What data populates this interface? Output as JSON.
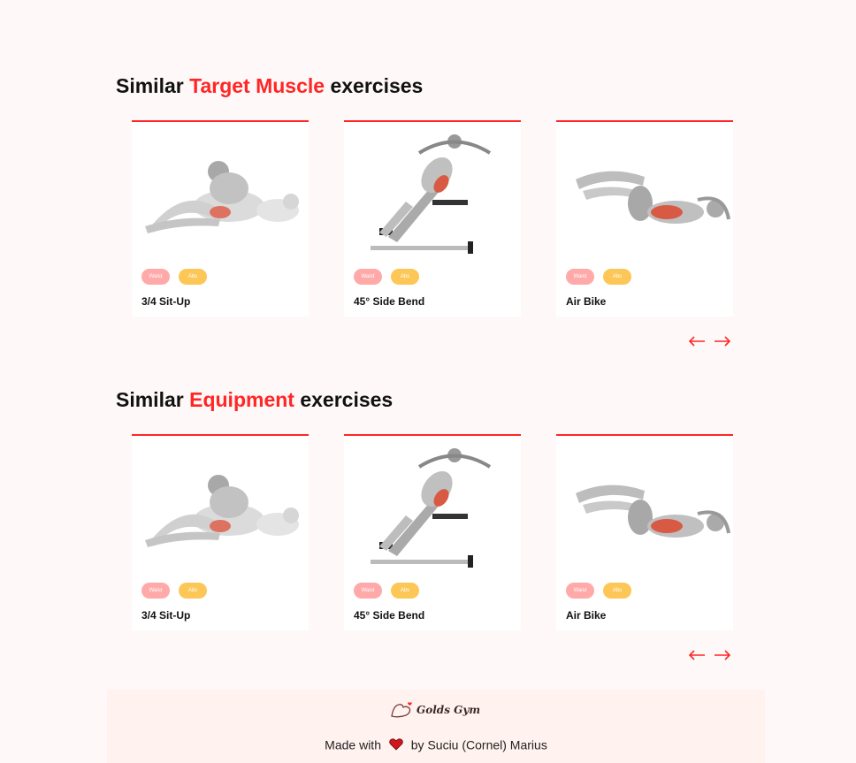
{
  "sections": [
    {
      "title_prefix": "Similar ",
      "title_accent": "Target Muscle",
      "title_suffix": " exercises",
      "cards": [
        {
          "name": "3/4 Sit-Up",
          "tags": [
            "Waist",
            "Abs"
          ]
        },
        {
          "name": "45° Side Bend",
          "tags": [
            "Waist",
            "Abs"
          ]
        },
        {
          "name": "Air Bike",
          "tags": [
            "Waist",
            "Abs"
          ]
        }
      ]
    },
    {
      "title_prefix": "Similar ",
      "title_accent": "Equipment",
      "title_suffix": " exercises",
      "cards": [
        {
          "name": "3/4 Sit-Up",
          "tags": [
            "Waist",
            "Abs"
          ]
        },
        {
          "name": "45° Side Bend",
          "tags": [
            "Waist",
            "Abs"
          ]
        },
        {
          "name": "Air Bike",
          "tags": [
            "Waist",
            "Abs"
          ]
        }
      ]
    }
  ],
  "nav": {
    "prev_icon": "arrow-left-icon",
    "next_icon": "arrow-right-icon"
  },
  "footer": {
    "logo_text": "Golds Gym",
    "made_with": "Made with",
    "by_text": "by Suciu (Cornel) Marius"
  },
  "colors": {
    "accent": "#ff2625",
    "waist_tag": "#ffa9a9",
    "abs_tag": "#fcc757",
    "background": "#fff8f8",
    "footer_bg": "#fff2ef"
  }
}
